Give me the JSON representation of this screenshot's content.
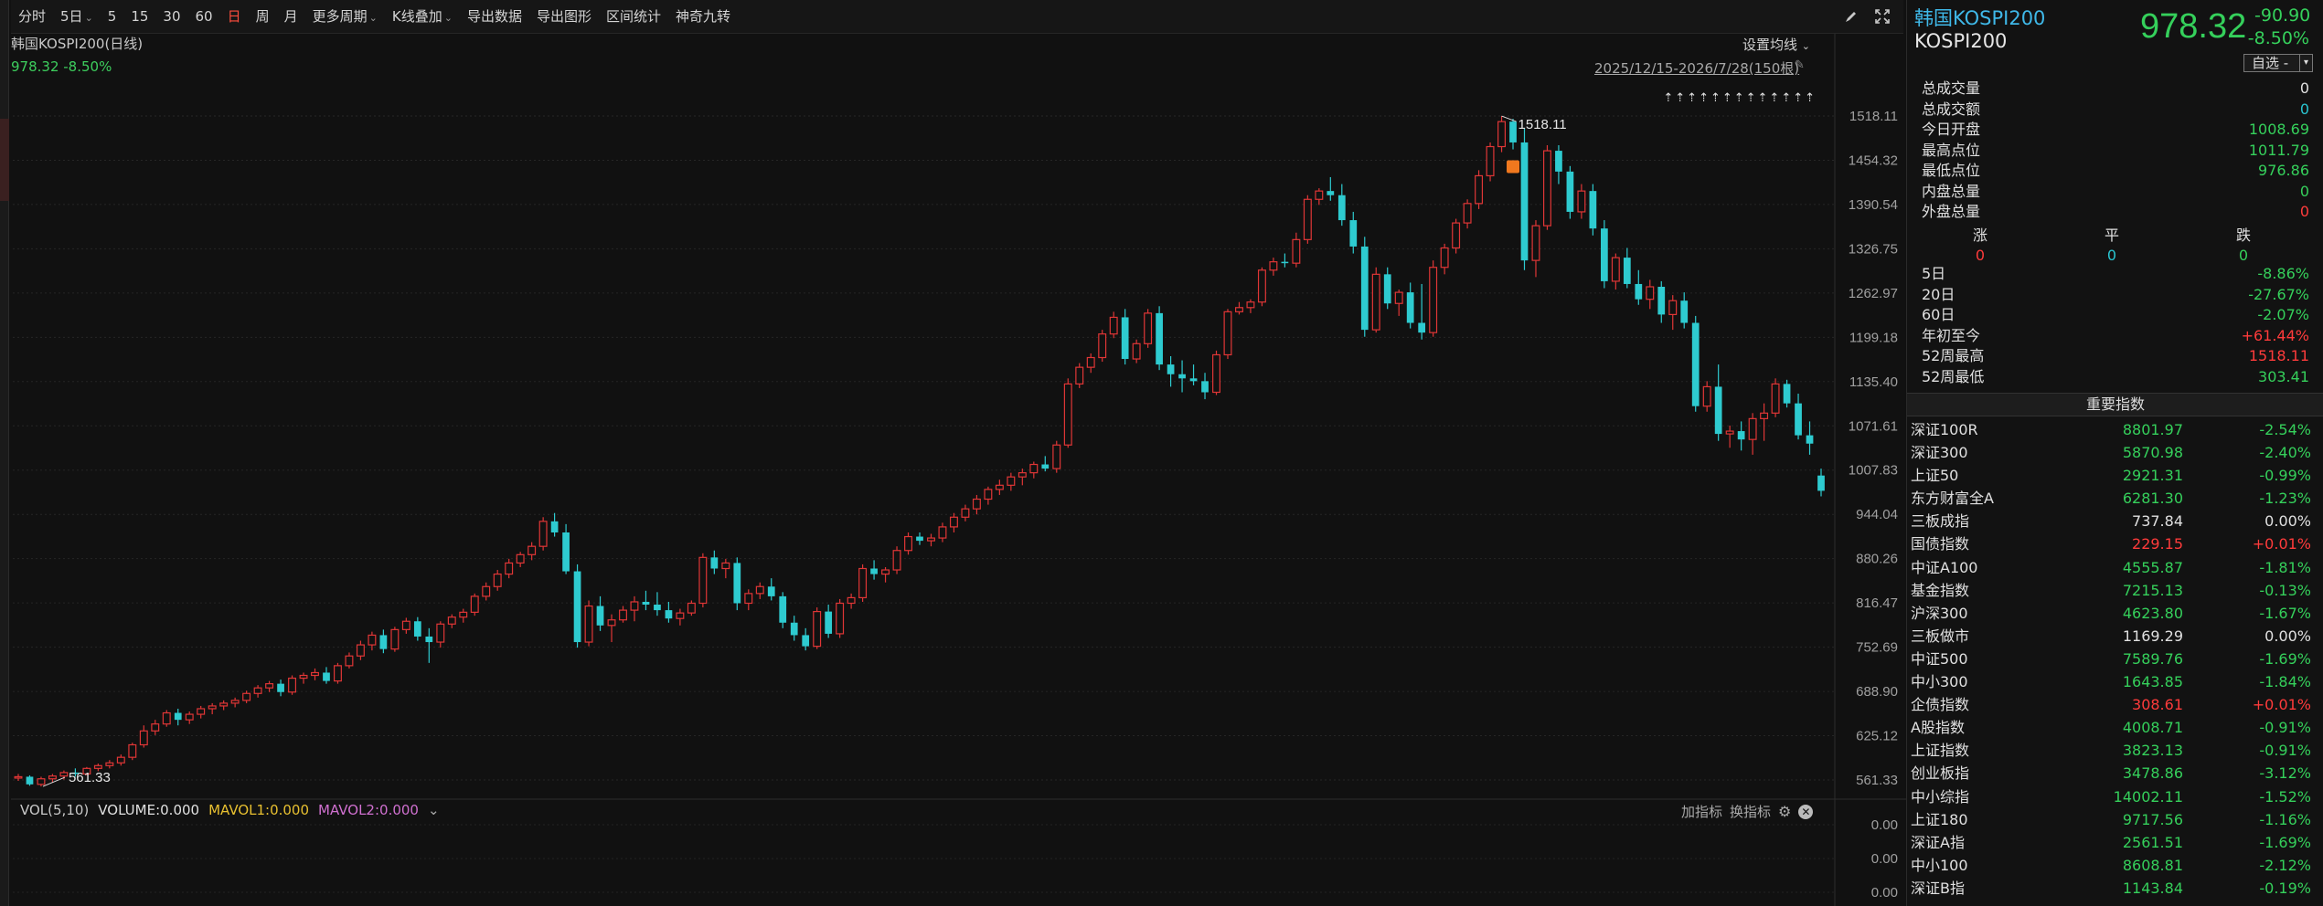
{
  "toolbar": {
    "items": [
      {
        "label": "分时",
        "caret": false,
        "active": false
      },
      {
        "label": "5日",
        "caret": true,
        "active": false
      },
      {
        "label": "5",
        "caret": false,
        "active": false
      },
      {
        "label": "15",
        "caret": false,
        "active": false
      },
      {
        "label": "30",
        "caret": false,
        "active": false
      },
      {
        "label": "60",
        "caret": false,
        "active": false
      },
      {
        "label": "日",
        "caret": false,
        "active": true
      },
      {
        "label": "周",
        "caret": false,
        "active": false
      },
      {
        "label": "月",
        "caret": false,
        "active": false
      },
      {
        "label": "更多周期",
        "caret": true,
        "active": false
      },
      {
        "label": "K线叠加",
        "caret": true,
        "active": false
      },
      {
        "label": "导出数据",
        "caret": false,
        "active": false
      },
      {
        "label": "导出图形",
        "caret": false,
        "active": false
      },
      {
        "label": "区间统计",
        "caret": false,
        "active": false
      },
      {
        "label": "神奇九转",
        "caret": false,
        "active": false
      }
    ],
    "icons": [
      "draw-pen-icon",
      "fullscreen-icon"
    ]
  },
  "chart": {
    "title": "韩国KOSPI200(日线)",
    "price_line": "978.32 -8.50%",
    "setting_label": "设置均线",
    "range_label": "2025/12/15-2026/7/28(150根)",
    "high_marker": "1518.11",
    "low_marker": "561.33",
    "vol_label": "VOL(5,10)",
    "vol_value": "VOLUME:0.000",
    "mavol1": "MAVOL1:0.000",
    "mavol2": "MAVOL2:0.000",
    "vol_axis": [
      "0.00",
      "0.00",
      "0.00"
    ],
    "add_indicator": "加指标",
    "switch_indicator": "换指标",
    "arrows_label": "⇡⇡⇡⇡⇡⇡⇡⇡⇡⇡⇡⇡⇡",
    "up_color": "#e03636",
    "down_color": "#2ecbd0"
  },
  "chart_data": {
    "type": "candlestick",
    "y_ticks": [
      "1518.11",
      "1454.32",
      "1390.54",
      "1326.75",
      "1262.97",
      "1199.18",
      "1135.40",
      "1071.61",
      "1007.83",
      "944.04",
      "880.26",
      "816.47",
      "752.69",
      "688.90",
      "625.12",
      "561.33"
    ],
    "ylim": [
      561.33,
      1518.11
    ],
    "grid": true,
    "last_close": 978.32,
    "high": 1518.11,
    "low": 561.33,
    "candles": [
      [
        565,
        570,
        560,
        566
      ],
      [
        566,
        568,
        553,
        555
      ],
      [
        555,
        566,
        552,
        563
      ],
      [
        563,
        570,
        558,
        567
      ],
      [
        567,
        575,
        562,
        572
      ],
      [
        572,
        578,
        566,
        570
      ],
      [
        570,
        580,
        568,
        578
      ],
      [
        578,
        585,
        574,
        582
      ],
      [
        582,
        590,
        578,
        586
      ],
      [
        586,
        598,
        582,
        594
      ],
      [
        594,
        615,
        590,
        612
      ],
      [
        612,
        640,
        608,
        632
      ],
      [
        632,
        648,
        626,
        642
      ],
      [
        642,
        662,
        638,
        658
      ],
      [
        658,
        664,
        640,
        648
      ],
      [
        648,
        660,
        642,
        656
      ],
      [
        656,
        668,
        650,
        664
      ],
      [
        664,
        672,
        656,
        668
      ],
      [
        668,
        676,
        662,
        672
      ],
      [
        672,
        680,
        666,
        676
      ],
      [
        676,
        690,
        672,
        686
      ],
      [
        686,
        698,
        680,
        694
      ],
      [
        694,
        704,
        688,
        700
      ],
      [
        700,
        706,
        682,
        688
      ],
      [
        688,
        712,
        684,
        708
      ],
      [
        708,
        716,
        700,
        712
      ],
      [
        712,
        722,
        705,
        716
      ],
      [
        716,
        724,
        700,
        704
      ],
      [
        704,
        730,
        700,
        726
      ],
      [
        726,
        745,
        722,
        740
      ],
      [
        740,
        762,
        734,
        756
      ],
      [
        756,
        775,
        748,
        770
      ],
      [
        770,
        778,
        744,
        750
      ],
      [
        750,
        782,
        746,
        778
      ],
      [
        778,
        795,
        772,
        790
      ],
      [
        790,
        796,
        762,
        768
      ],
      [
        768,
        780,
        730,
        760
      ],
      [
        760,
        790,
        752,
        786
      ],
      [
        786,
        800,
        780,
        796
      ],
      [
        796,
        808,
        788,
        803
      ],
      [
        803,
        830,
        798,
        826
      ],
      [
        826,
        846,
        820,
        840
      ],
      [
        840,
        864,
        834,
        858
      ],
      [
        858,
        880,
        852,
        874
      ],
      [
        874,
        890,
        868,
        886
      ],
      [
        886,
        904,
        878,
        898
      ],
      [
        898,
        940,
        892,
        934
      ],
      [
        934,
        946,
        912,
        918
      ],
      [
        918,
        930,
        858,
        862
      ],
      [
        862,
        872,
        752,
        760
      ],
      [
        760,
        820,
        754,
        812
      ],
      [
        812,
        826,
        776,
        784
      ],
      [
        784,
        800,
        760,
        792
      ],
      [
        792,
        812,
        788,
        806
      ],
      [
        806,
        826,
        790,
        818
      ],
      [
        818,
        834,
        806,
        814
      ],
      [
        814,
        832,
        798,
        806
      ],
      [
        806,
        818,
        788,
        794
      ],
      [
        794,
        808,
        784,
        802
      ],
      [
        802,
        820,
        798,
        816
      ],
      [
        816,
        888,
        810,
        882
      ],
      [
        882,
        892,
        858,
        866
      ],
      [
        866,
        880,
        852,
        874
      ],
      [
        874,
        882,
        806,
        816
      ],
      [
        816,
        836,
        806,
        830
      ],
      [
        830,
        846,
        822,
        840
      ],
      [
        840,
        852,
        820,
        826
      ],
      [
        826,
        832,
        780,
        788
      ],
      [
        788,
        798,
        762,
        770
      ],
      [
        770,
        780,
        748,
        754
      ],
      [
        754,
        810,
        750,
        804
      ],
      [
        804,
        814,
        766,
        772
      ],
      [
        772,
        822,
        766,
        816
      ],
      [
        816,
        830,
        808,
        824
      ],
      [
        824,
        872,
        818,
        866
      ],
      [
        866,
        878,
        850,
        858
      ],
      [
        858,
        868,
        846,
        864
      ],
      [
        864,
        898,
        858,
        892
      ],
      [
        892,
        918,
        886,
        912
      ],
      [
        912,
        918,
        900,
        906
      ],
      [
        906,
        916,
        898,
        910
      ],
      [
        910,
        932,
        904,
        926
      ],
      [
        926,
        946,
        918,
        940
      ],
      [
        940,
        958,
        934,
        952
      ],
      [
        952,
        972,
        944,
        966
      ],
      [
        966,
        984,
        958,
        980
      ],
      [
        980,
        994,
        972,
        986
      ],
      [
        986,
        1004,
        978,
        998
      ],
      [
        998,
        1010,
        986,
        1004
      ],
      [
        1004,
        1020,
        996,
        1016
      ],
      [
        1016,
        1028,
        1006,
        1010
      ],
      [
        1010,
        1050,
        1004,
        1044
      ],
      [
        1044,
        1140,
        1040,
        1132
      ],
      [
        1132,
        1162,
        1126,
        1156
      ],
      [
        1156,
        1176,
        1148,
        1170
      ],
      [
        1170,
        1210,
        1164,
        1204
      ],
      [
        1204,
        1236,
        1198,
        1228
      ],
      [
        1228,
        1240,
        1160,
        1168
      ],
      [
        1168,
        1196,
        1162,
        1190
      ],
      [
        1190,
        1240,
        1184,
        1234
      ],
      [
        1234,
        1244,
        1152,
        1160
      ],
      [
        1160,
        1172,
        1128,
        1146
      ],
      [
        1146,
        1166,
        1120,
        1140
      ],
      [
        1140,
        1160,
        1130,
        1136
      ],
      [
        1136,
        1148,
        1110,
        1120
      ],
      [
        1120,
        1180,
        1116,
        1174
      ],
      [
        1174,
        1240,
        1168,
        1236
      ],
      [
        1236,
        1250,
        1232,
        1242
      ],
      [
        1242,
        1254,
        1234,
        1250
      ],
      [
        1250,
        1300,
        1244,
        1296
      ],
      [
        1296,
        1314,
        1288,
        1308
      ],
      [
        1308,
        1320,
        1300,
        1306
      ],
      [
        1306,
        1350,
        1300,
        1340
      ],
      [
        1340,
        1404,
        1334,
        1398
      ],
      [
        1398,
        1414,
        1390,
        1410
      ],
      [
        1410,
        1430,
        1396,
        1404
      ],
      [
        1404,
        1420,
        1360,
        1368
      ],
      [
        1368,
        1380,
        1320,
        1330
      ],
      [
        1330,
        1344,
        1200,
        1210
      ],
      [
        1210,
        1300,
        1206,
        1290
      ],
      [
        1290,
        1300,
        1240,
        1248
      ],
      [
        1248,
        1268,
        1230,
        1264
      ],
      [
        1264,
        1278,
        1212,
        1220
      ],
      [
        1220,
        1276,
        1196,
        1206
      ],
      [
        1206,
        1310,
        1200,
        1300
      ],
      [
        1300,
        1334,
        1290,
        1328
      ],
      [
        1328,
        1370,
        1320,
        1364
      ],
      [
        1364,
        1398,
        1356,
        1392
      ],
      [
        1392,
        1440,
        1384,
        1432
      ],
      [
        1432,
        1480,
        1424,
        1474
      ],
      [
        1474,
        1518,
        1466,
        1510
      ],
      [
        1510,
        1514,
        1470,
        1480
      ],
      [
        1480,
        1500,
        1296,
        1310
      ],
      [
        1310,
        1368,
        1286,
        1360
      ],
      [
        1360,
        1476,
        1354,
        1468
      ],
      [
        1468,
        1476,
        1420,
        1438
      ],
      [
        1438,
        1446,
        1370,
        1380
      ],
      [
        1380,
        1420,
        1370,
        1410
      ],
      [
        1410,
        1420,
        1346,
        1356
      ],
      [
        1356,
        1368,
        1270,
        1280
      ],
      [
        1280,
        1320,
        1268,
        1314
      ],
      [
        1314,
        1328,
        1270,
        1276
      ],
      [
        1276,
        1296,
        1246,
        1254
      ],
      [
        1254,
        1282,
        1240,
        1272
      ],
      [
        1272,
        1280,
        1220,
        1232
      ],
      [
        1232,
        1260,
        1210,
        1252
      ],
      [
        1252,
        1264,
        1212,
        1220
      ],
      [
        1220,
        1230,
        1092,
        1100
      ],
      [
        1100,
        1136,
        1092,
        1128
      ],
      [
        1128,
        1160,
        1050,
        1060
      ],
      [
        1060,
        1072,
        1040,
        1064
      ],
      [
        1064,
        1078,
        1036,
        1052
      ],
      [
        1052,
        1090,
        1030,
        1082
      ],
      [
        1082,
        1104,
        1050,
        1090
      ],
      [
        1090,
        1140,
        1084,
        1132
      ],
      [
        1132,
        1138,
        1098,
        1104
      ],
      [
        1104,
        1118,
        1052,
        1058
      ],
      [
        1058,
        1078,
        1030,
        1046
      ],
      [
        1000,
        1010,
        970,
        978
      ]
    ]
  },
  "quote": {
    "name": "韩国KOSPI200",
    "code": "KOSPI200",
    "price": "978.32",
    "change": "-90.90",
    "pct": "-8.50%",
    "select_label": "自选 -",
    "stats": [
      {
        "label": "总成交量",
        "value": "0",
        "cls": "fl"
      },
      {
        "label": "总成交额",
        "value": "0",
        "cls": "cy"
      },
      {
        "label": "今日开盘",
        "value": "1008.69",
        "cls": "dn"
      },
      {
        "label": "最高点位",
        "value": "1011.79",
        "cls": "dn"
      },
      {
        "label": "最低点位",
        "value": "976.86",
        "cls": "dn"
      },
      {
        "label": "内盘总量",
        "value": "0",
        "cls": "dn"
      },
      {
        "label": "外盘总量",
        "value": "0",
        "cls": "up"
      }
    ],
    "tri_labels": [
      "涨",
      "平",
      "跌"
    ],
    "tri_values": [
      "0",
      "0",
      "0"
    ],
    "perf": [
      {
        "label": "5日",
        "value": "-8.86%",
        "cls": "dn"
      },
      {
        "label": "20日",
        "value": "-27.67%",
        "cls": "dn"
      },
      {
        "label": "60日",
        "value": "-2.07%",
        "cls": "dn"
      },
      {
        "label": "年初至今",
        "value": "+61.44%",
        "cls": "up"
      },
      {
        "label": "52周最高",
        "value": "1518.11",
        "cls": "up"
      },
      {
        "label": "52周最低",
        "value": "303.41",
        "cls": "dn"
      }
    ]
  },
  "indices": {
    "header": "重要指数",
    "rows": [
      {
        "name": "深证100R",
        "value": "8801.97",
        "pct": "-2.54%",
        "vc": "dn",
        "pc": "dn"
      },
      {
        "name": "深证300",
        "value": "5870.98",
        "pct": "-2.40%",
        "vc": "dn",
        "pc": "dn"
      },
      {
        "name": "上证50",
        "value": "2921.31",
        "pct": "-0.99%",
        "vc": "dn",
        "pc": "dn"
      },
      {
        "name": "东方财富全A",
        "value": "6281.30",
        "pct": "-1.23%",
        "vc": "dn",
        "pc": "dn"
      },
      {
        "name": "三板成指",
        "value": "737.84",
        "pct": "0.00%",
        "vc": "fl",
        "pc": "fl"
      },
      {
        "name": "国债指数",
        "value": "229.15",
        "pct": "+0.01%",
        "vc": "up",
        "pc": "up"
      },
      {
        "name": "中证A100",
        "value": "4555.87",
        "pct": "-1.81%",
        "vc": "dn",
        "pc": "dn"
      },
      {
        "name": "基金指数",
        "value": "7215.13",
        "pct": "-0.13%",
        "vc": "dn",
        "pc": "dn"
      },
      {
        "name": "沪深300",
        "value": "4623.80",
        "pct": "-1.67%",
        "vc": "dn",
        "pc": "dn"
      },
      {
        "name": "三板做市",
        "value": "1169.29",
        "pct": "0.00%",
        "vc": "fl",
        "pc": "fl"
      },
      {
        "name": "中证500",
        "value": "7589.76",
        "pct": "-1.69%",
        "vc": "dn",
        "pc": "dn"
      },
      {
        "name": "中小300",
        "value": "1643.85",
        "pct": "-1.84%",
        "vc": "dn",
        "pc": "dn"
      },
      {
        "name": "企债指数",
        "value": "308.61",
        "pct": "+0.01%",
        "vc": "up",
        "pc": "up"
      },
      {
        "name": "A股指数",
        "value": "4008.71",
        "pct": "-0.91%",
        "vc": "dn",
        "pc": "dn"
      },
      {
        "name": "上证指数",
        "value": "3823.13",
        "pct": "-0.91%",
        "vc": "dn",
        "pc": "dn"
      },
      {
        "name": "创业板指",
        "value": "3478.86",
        "pct": "-3.12%",
        "vc": "dn",
        "pc": "dn"
      },
      {
        "name": "中小综指",
        "value": "14002.11",
        "pct": "-1.52%",
        "vc": "dn",
        "pc": "dn"
      },
      {
        "name": "上证180",
        "value": "9717.56",
        "pct": "-1.16%",
        "vc": "dn",
        "pc": "dn"
      },
      {
        "name": "深证A指",
        "value": "2561.51",
        "pct": "-1.69%",
        "vc": "dn",
        "pc": "dn"
      },
      {
        "name": "中小100",
        "value": "8608.81",
        "pct": "-2.12%",
        "vc": "dn",
        "pc": "dn"
      },
      {
        "name": "深证B指",
        "value": "1143.84",
        "pct": "-0.19%",
        "vc": "dn",
        "pc": "dn"
      }
    ]
  }
}
